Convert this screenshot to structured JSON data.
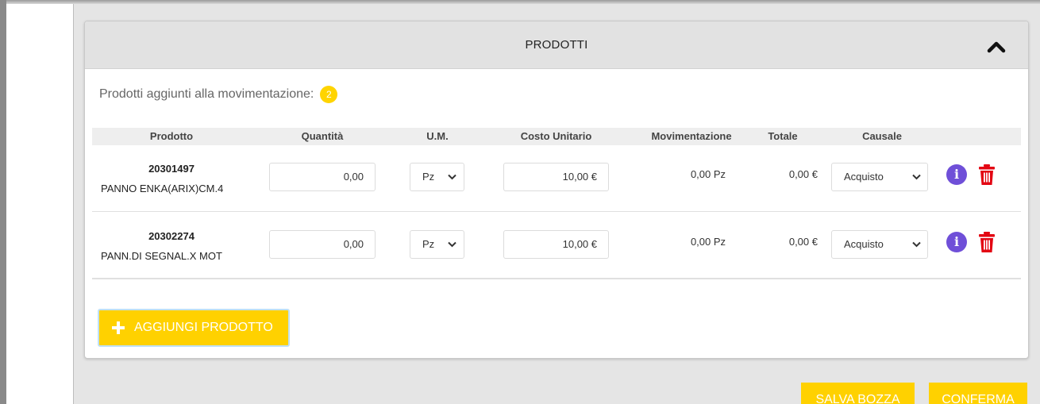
{
  "panel": {
    "title": "PRODOTTI",
    "subtitle": "Prodotti aggiunti alla movimentazione:",
    "count": "2"
  },
  "columns": {
    "prodotto": "Prodotto",
    "quantita": "Quantità",
    "um": "U.M.",
    "costo": "Costo Unitario",
    "movimentazione": "Movimentazione",
    "totale": "Totale",
    "causale": "Causale"
  },
  "rows": [
    {
      "code": "20301497",
      "name": "PANNO ENKA(ARIX)CM.4",
      "quantity": "0,00",
      "um": "Pz",
      "cost": "10,00 €",
      "movimentazione": "0,00 Pz",
      "totale": "0,00 €",
      "causale": "Acquisto"
    },
    {
      "code": "20302274",
      "name": "PANN.DI SEGNAL.X MOT",
      "quantity": "0,00",
      "um": "Pz",
      "cost": "10,00 €",
      "movimentazione": "0,00 Pz",
      "totale": "0,00 €",
      "causale": "Acquisto"
    }
  ],
  "actions": {
    "add_product": "AGGIUNGI PRODOTTO",
    "save_draft": "SALVA BOZZA",
    "confirm": "CONFERMA"
  },
  "colors": {
    "accent_yellow": "#ffd100",
    "info_purple": "#6f4fd8",
    "delete_red": "#e30613"
  },
  "icons": {
    "collapse": "chevron-up-icon",
    "info": "info-icon",
    "delete": "trash-icon",
    "add": "plus-icon",
    "dropdown": "chevron-down-icon"
  }
}
